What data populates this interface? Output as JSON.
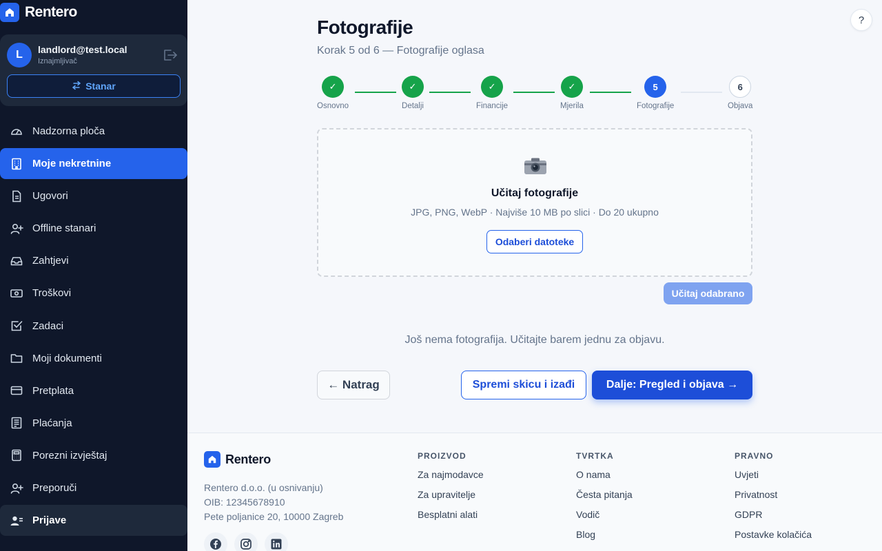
{
  "brand": {
    "name": "Rentero"
  },
  "user": {
    "initial": "L",
    "email": "landlord@test.local",
    "role": "Iznajmljivač",
    "switch_label": "Stanar"
  },
  "nav": [
    {
      "label": "Nadzorna ploča",
      "icon": "gauge-icon"
    },
    {
      "label": "Moje nekretnine",
      "icon": "building-icon"
    },
    {
      "label": "Ugovori",
      "icon": "document-icon"
    },
    {
      "label": "Offline stanari",
      "icon": "user-plus-icon"
    },
    {
      "label": "Zahtjevi",
      "icon": "inbox-icon"
    },
    {
      "label": "Troškovi",
      "icon": "money-icon"
    },
    {
      "label": "Zadaci",
      "icon": "checkbox-icon"
    },
    {
      "label": "Moji dokumenti",
      "icon": "folder-icon"
    },
    {
      "label": "Pretplata",
      "icon": "credit-card-icon"
    },
    {
      "label": "Plaćanja",
      "icon": "receipt-icon"
    },
    {
      "label": "Porezni izvještaj",
      "icon": "calculator-icon"
    },
    {
      "label": "Preporuči",
      "icon": "user-plus-icon"
    },
    {
      "label": "Prijave",
      "icon": "user-card-icon"
    }
  ],
  "help": {
    "label": "?"
  },
  "page": {
    "title": "Fotografije",
    "subtitle": "Korak 5 od 6 — Fotografije oglasa"
  },
  "steps": [
    {
      "label": "Osnovno",
      "mark": "✓",
      "state": "done"
    },
    {
      "label": "Detalji",
      "mark": "✓",
      "state": "done"
    },
    {
      "label": "Financije",
      "mark": "✓",
      "state": "done"
    },
    {
      "label": "Mjerila",
      "mark": "✓",
      "state": "done"
    },
    {
      "label": "Fotografije",
      "mark": "5",
      "state": "current"
    },
    {
      "label": "Objava",
      "mark": "6",
      "state": "pending"
    }
  ],
  "upload": {
    "title": "Učitaj fotografije",
    "hint": "JPG, PNG, WebP · Najviše 10 MB po slici · Do 20 ukupno",
    "choose_label": "Odaberi datoteke",
    "upload_selected_label": "Učitaj odabrano",
    "empty_message": "Još nema fotografija. Učitajte barem jednu za objavu."
  },
  "actions": {
    "back": "← Natrag",
    "save_draft": "Spremi skicu i izađi",
    "next": "Dalje: Pregled i objava →"
  },
  "footer": {
    "brand": "Rentero",
    "company": "Rentero d.o.o. (u osnivanju)",
    "oib": "OIB: 12345678910",
    "address": "Pete poljanice 20, 10000 Zagreb",
    "columns": [
      {
        "heading": "PROIZVOD",
        "links": [
          "Za najmodavce",
          "Za upravitelje",
          "Besplatni alati"
        ]
      },
      {
        "heading": "TVRTKA",
        "links": [
          "O nama",
          "Česta pitanja",
          "Vodič",
          "Blog"
        ]
      },
      {
        "heading": "PRAVNO",
        "links": [
          "Uvjeti",
          "Privatnost",
          "GDPR",
          "Postavke kolačića"
        ]
      }
    ]
  },
  "colors": {
    "primary": "#2563eb",
    "success": "#16a34a",
    "sidebar": "#0f172a"
  }
}
